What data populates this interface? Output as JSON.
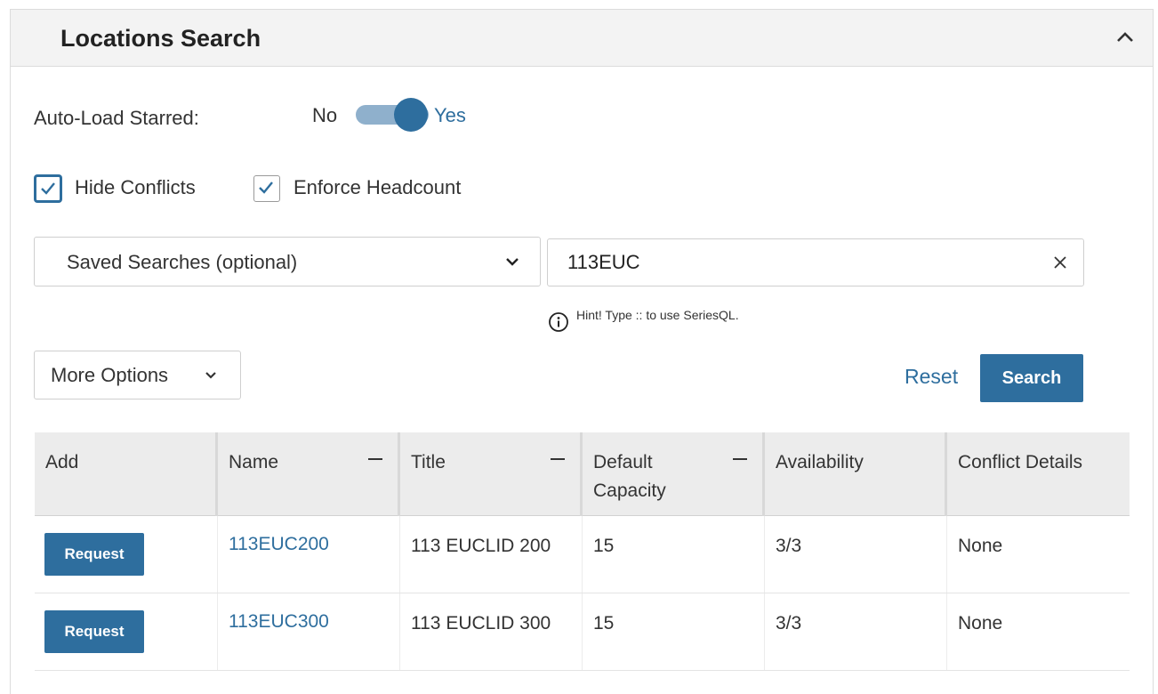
{
  "panel": {
    "title": "Locations Search",
    "collapse_icon": "chevron-up-icon"
  },
  "auto_load": {
    "label": "Auto-Load Starred:",
    "off_label": "No",
    "on_label": "Yes",
    "state": "on"
  },
  "checkboxes": [
    {
      "label": "Hide Conflicts",
      "checked": true
    },
    {
      "label": "Enforce Headcount",
      "checked": true
    }
  ],
  "saved_searches": {
    "selected": "Saved Searches (optional)"
  },
  "search": {
    "value": "113EUC",
    "hint": "Hint! Type :: to use SeriesQL."
  },
  "more_options": {
    "label": "More Options"
  },
  "actions": {
    "reset": "Reset",
    "search": "Search"
  },
  "table": {
    "columns": [
      {
        "label": "Add"
      },
      {
        "label": "Name"
      },
      {
        "label": "Title"
      },
      {
        "label": "Default Capacity"
      },
      {
        "label": "Availability"
      },
      {
        "label": "Conflict Details"
      }
    ],
    "rows": [
      {
        "action": "Request",
        "name": "113EUC200",
        "title": "113 EUCLID 200",
        "capacity": "15",
        "availability": "3/3",
        "conflicts": "None"
      },
      {
        "action": "Request",
        "name": "113EUC300",
        "title": "113 EUCLID 300",
        "capacity": "15",
        "availability": "3/3",
        "conflicts": "None"
      }
    ]
  },
  "colors": {
    "accent": "#2e6e9e",
    "toggle_track": "#8fb0cc",
    "header_bg": "#f3f3f3",
    "grid_header_bg": "#ececec"
  }
}
